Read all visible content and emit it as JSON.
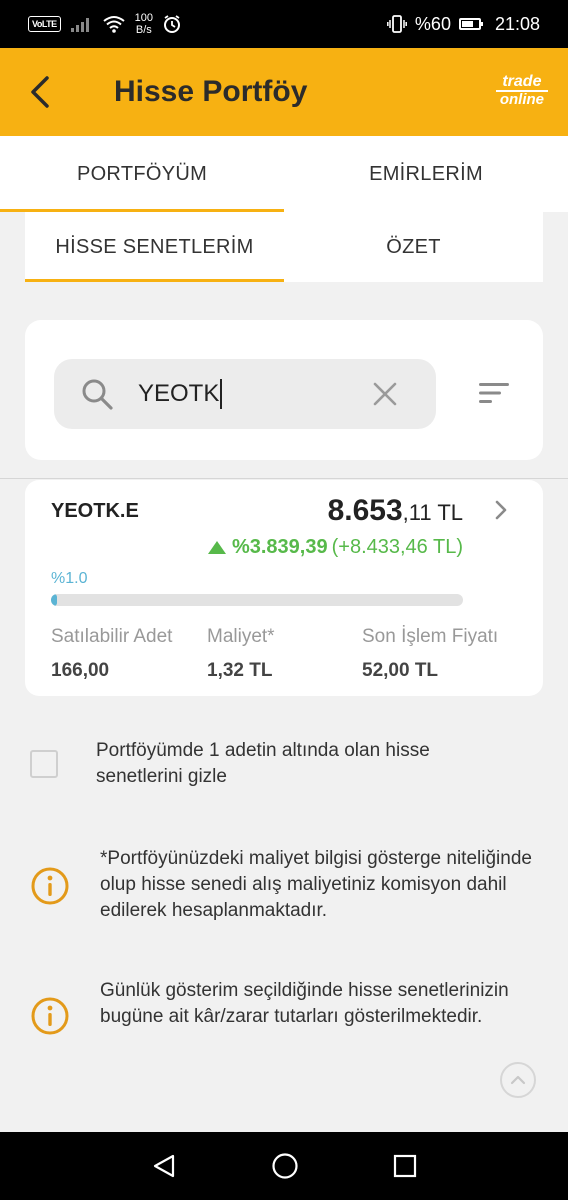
{
  "status_bar": {
    "volte": "VoLTE",
    "speed_value": "100",
    "speed_unit": "B/s",
    "battery": "%60",
    "time": "21:08"
  },
  "header": {
    "title": "Hisse Portföy",
    "brand_line1": "trade",
    "brand_line2": "online",
    "accent_color": "#f7b112"
  },
  "main_tabs": [
    {
      "label": "PORTFÖYÜM",
      "active": true
    },
    {
      "label": "EMİRLERİM",
      "active": false
    }
  ],
  "sub_tabs": [
    {
      "label": "HİSSE SENETLERİM",
      "active": true
    },
    {
      "label": "ÖZET",
      "active": false
    }
  ],
  "search": {
    "value": "YEOTK"
  },
  "stock": {
    "symbol": "YEOTK.E",
    "value_main": "8.653",
    "value_decimal": ",11 TL",
    "change_pct": "%3.839,39",
    "change_amount": "(+8.433,46 TL)",
    "portfolio_share_label": "%1.0",
    "portfolio_share_fraction": 0.01,
    "columns": [
      {
        "label": "Satılabilir Adet",
        "value": "166,00"
      },
      {
        "label": "Maliyet*",
        "value": "1,32 TL"
      },
      {
        "label": "Son İşlem Fiyatı",
        "value": "52,00 TL"
      }
    ],
    "positive_color": "#57b94a",
    "share_color": "#5bb4d4"
  },
  "hide_small_checkbox": {
    "label": "Portföyümde 1 adetin altında olan hisse senetlerini gizle",
    "checked": false
  },
  "info_notes": [
    "*Portföyünüzdeki maliyet bilgisi gösterge niteliğinde olup hisse senedi alış maliyetiniz komisyon dahil edilerek hesaplanmaktadır.",
    "Günlük gösterim seçildiğinde hisse senetlerinizin bugüne ait kâr/zarar tutarları gösterilmektedir."
  ]
}
